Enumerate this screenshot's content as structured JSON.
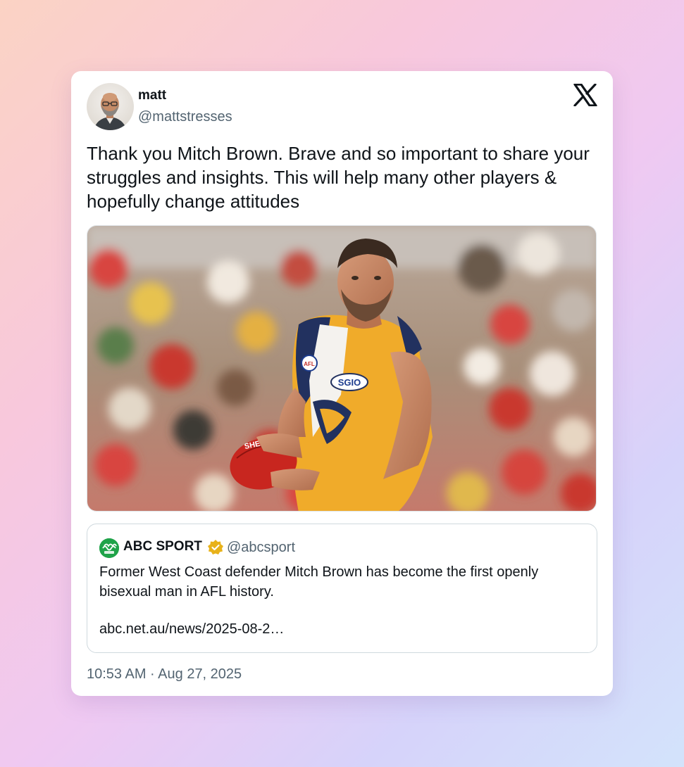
{
  "tweet": {
    "author_name": "matt",
    "author_handle": "@mattstresses",
    "text": "Thank you Mitch Brown. Brave and so important to share your struggles and insights. This will help many other players & hopefully change attitudes",
    "timestamp": "10:53 AM · Aug 27, 2025",
    "platform_icon": "x-logo-icon"
  },
  "media": {
    "description_icon": "photo-image",
    "jersey_lettering": "SGIO",
    "badge_lettering": "AFL"
  },
  "quote": {
    "source_name": "ABC SPORT",
    "source_handle": "@abcsport",
    "verified_icon": "verified-badge-icon",
    "text": "Former West Coast defender Mitch Brown has become the first openly bisexual man in AFL history.",
    "link": "abc.net.au/news/2025-08-2…",
    "logo_color": "#1fa349",
    "badge_color": "#e8b21a"
  },
  "colors": {
    "primary_text": "#0f1419",
    "secondary_text": "#536471",
    "border": "#cfd9de"
  }
}
